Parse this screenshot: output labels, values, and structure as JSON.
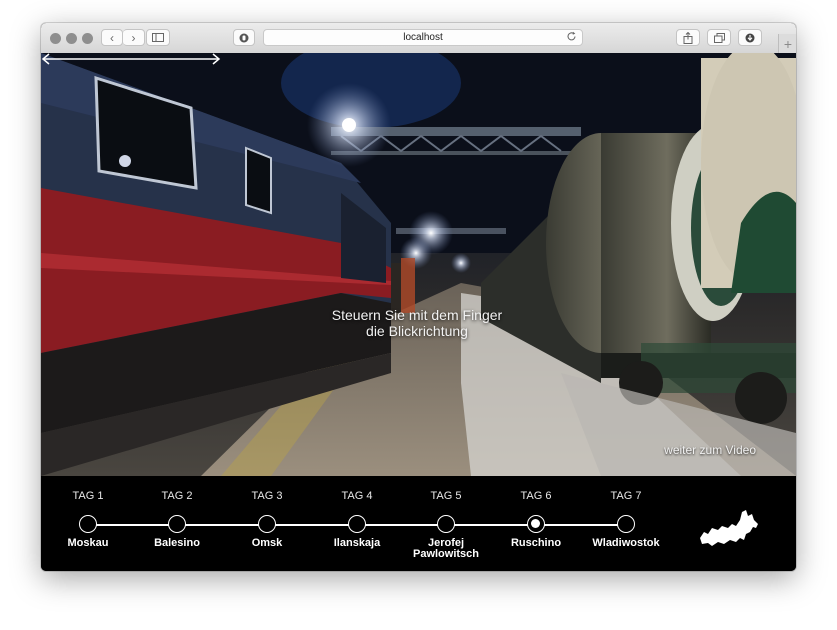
{
  "browser": {
    "url": "localhost",
    "nav_back": "‹",
    "nav_forward": "›",
    "sidebar_icon": "sidebar-icon",
    "privacy_icon": "shield-icon",
    "reload_icon": "reload-icon",
    "share_icon": "share-icon",
    "tabs_icon": "tabs-icon",
    "download_icon": "download-icon",
    "new_tab": "+"
  },
  "panorama": {
    "hint_line1": "Steuern Sie mit dem Finger",
    "hint_line2": "die Blickrichtung",
    "continue_label": "weiter zum Video"
  },
  "timeline": {
    "days": [
      {
        "label": "TAG 1",
        "city": "Moskau",
        "city2": "",
        "active": false
      },
      {
        "label": "TAG 2",
        "city": "Balesino",
        "city2": "",
        "active": false
      },
      {
        "label": "TAG 3",
        "city": "Omsk",
        "city2": "",
        "active": false
      },
      {
        "label": "TAG 4",
        "city": "Ilanskaja",
        "city2": "",
        "active": false
      },
      {
        "label": "TAG 5",
        "city": "Jerofej",
        "city2": "Pawlowitsch",
        "active": false
      },
      {
        "label": "TAG 6",
        "city": "Ruschino",
        "city2": "",
        "active": true
      },
      {
        "label": "TAG 7",
        "city": "Wladiwostok",
        "city2": "",
        "active": false
      }
    ],
    "map_icon": "russia-map-icon"
  }
}
